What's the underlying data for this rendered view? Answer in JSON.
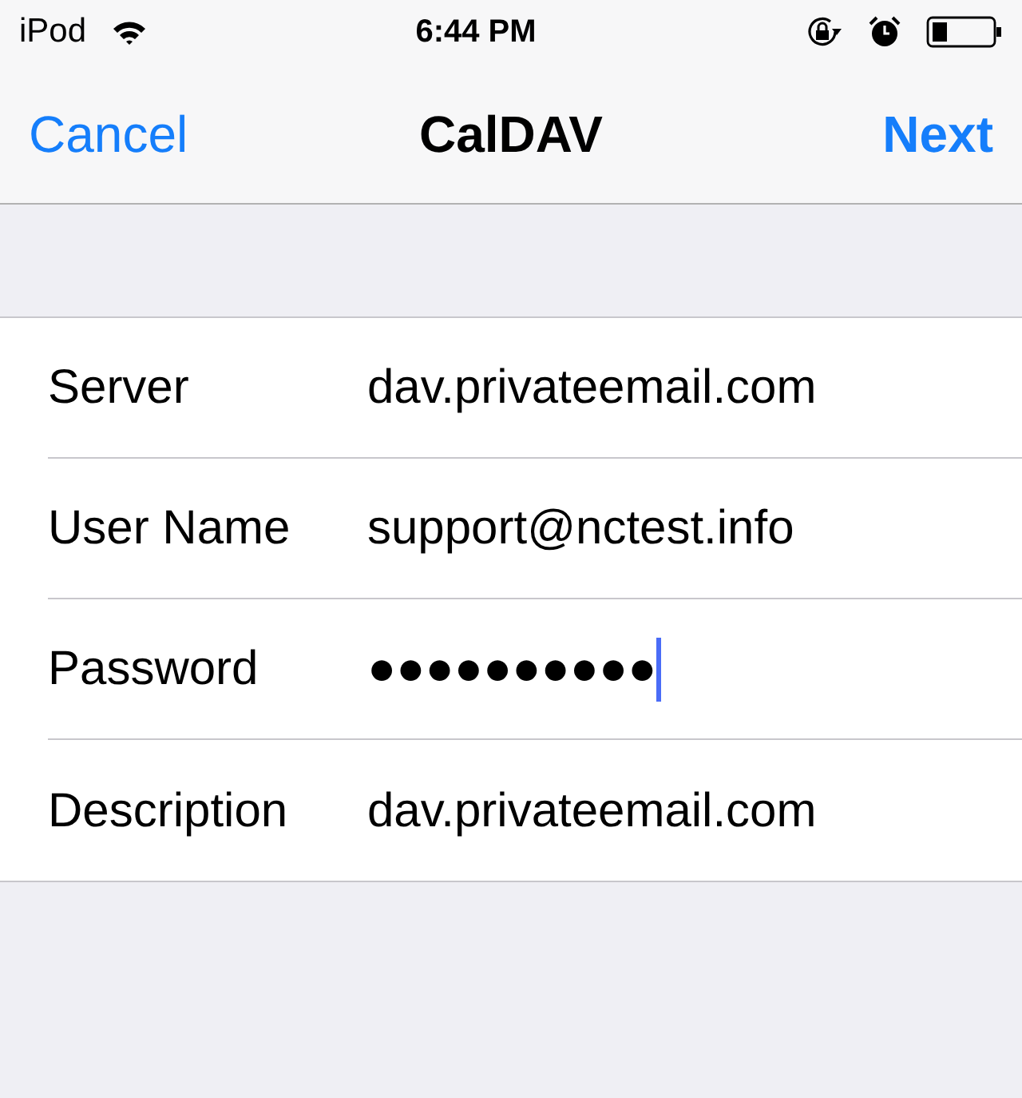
{
  "status_bar": {
    "carrier": "iPod",
    "time": "6:44 PM"
  },
  "nav_bar": {
    "left_button": "Cancel",
    "title": "CalDAV",
    "right_button": "Next"
  },
  "fields": [
    {
      "label": "Server",
      "value": "dav.privateemail.com",
      "focused": false
    },
    {
      "label": "User Name",
      "value": "support@nctest.info",
      "focused": false
    },
    {
      "label": "Password",
      "value": "●●●●●●●●●●",
      "focused": true
    },
    {
      "label": "Description",
      "value": "dav.privateemail.com",
      "focused": false
    }
  ]
}
